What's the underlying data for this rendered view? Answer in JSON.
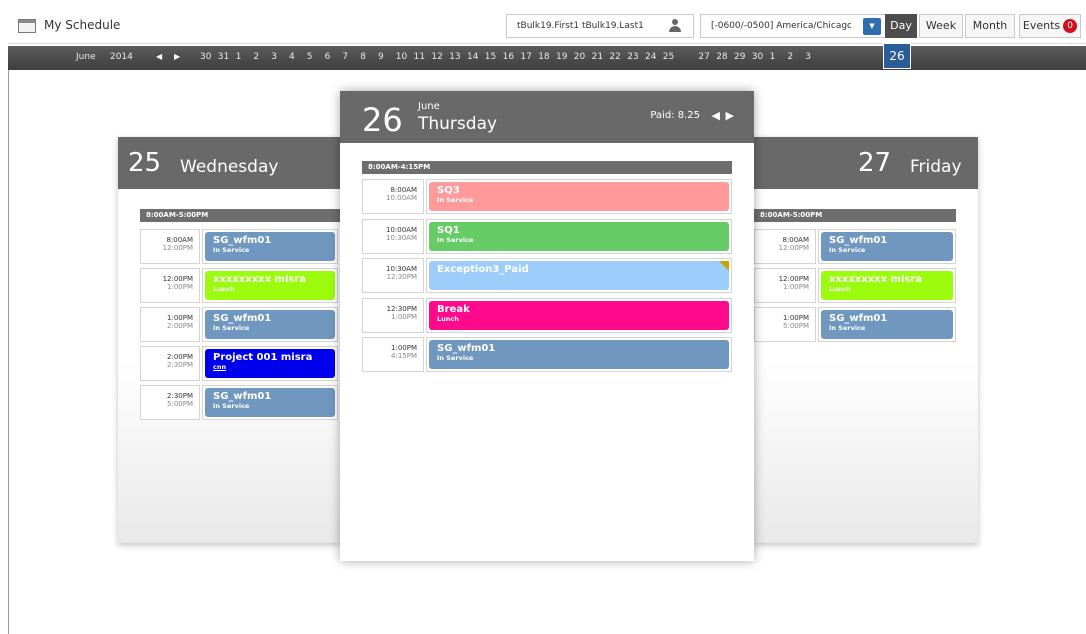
{
  "app": {
    "title": "My Schedule"
  },
  "user": {
    "name": "tBulk19.First1 tBulk19.Last1"
  },
  "timezone": {
    "value": "[-0600/-0500] America/Chicago"
  },
  "views": {
    "day": "Day",
    "week": "Week",
    "month": "Month",
    "events": "Events",
    "events_count": "0"
  },
  "datebar": {
    "month": "June",
    "year": "2014",
    "dates": [
      "30",
      "31",
      "1",
      "2",
      "3",
      "4",
      "5",
      "6",
      "7",
      "8",
      "9",
      "10",
      "11",
      "12",
      "13",
      "14",
      "15",
      "16",
      "17",
      "18",
      "19",
      "20",
      "21",
      "22",
      "23",
      "24",
      "25",
      "26",
      "27",
      "28",
      "29",
      "30",
      "1",
      "2",
      "3"
    ],
    "current": "26"
  },
  "days": {
    "prev": {
      "num": "25",
      "name": "Wednesday",
      "shift": "8:00AM-5:00PM",
      "events": [
        {
          "start": "8:00AM",
          "end": "12:00PM",
          "name": "SG_wfm01",
          "sub": "In Service",
          "color": "#6f97c0"
        },
        {
          "start": "12:00PM",
          "end": "1:00PM",
          "name": "xxxxxxxxx misra",
          "sub": "Lunch",
          "color": "#9bfc0e"
        },
        {
          "start": "1:00PM",
          "end": "2:00PM",
          "name": "SG_wfm01",
          "sub": "In Service",
          "color": "#6f97c0"
        },
        {
          "start": "2:00PM",
          "end": "2:30PM",
          "name": "Project 001 misra",
          "sub": "cnn",
          "color": "#0000ee"
        },
        {
          "start": "2:30PM",
          "end": "5:00PM",
          "name": "SG_wfm01",
          "sub": "In Service",
          "color": "#6f97c0"
        }
      ]
    },
    "current": {
      "num": "26",
      "month": "June",
      "name": "Thursday",
      "paid": "Paid: 8.25",
      "shift": "8:00AM-4:15PM",
      "events": [
        {
          "start": "8:00AM",
          "end": "10:00AM",
          "name": "SQ3",
          "sub": "In Service",
          "color": "#ff9a9a"
        },
        {
          "start": "10:00AM",
          "end": "10:30AM",
          "name": "SQ1",
          "sub": "In Service",
          "color": "#66cc66"
        },
        {
          "start": "10:30AM",
          "end": "12:30PM",
          "name": "Exception3_Paid",
          "sub": "",
          "color": "#9ccdfb"
        },
        {
          "start": "12:30PM",
          "end": "1:00PM",
          "name": "Break",
          "sub": "Lunch",
          "color": "#ff0a8c"
        },
        {
          "start": "1:00PM",
          "end": "4:15PM",
          "name": "SG_wfm01",
          "sub": "In Service",
          "color": "#6f97c0"
        }
      ]
    },
    "next": {
      "num": "27",
      "name": "Friday",
      "shift": "8:00AM-5:00PM",
      "events": [
        {
          "start": "8:00AM",
          "end": "12:00PM",
          "name": "SG_wfm01",
          "sub": "In Service",
          "color": "#6f97c0"
        },
        {
          "start": "12:00PM",
          "end": "1:00PM",
          "name": "xxxxxxxxx misra",
          "sub": "Lunch",
          "color": "#9bfc0e"
        },
        {
          "start": "1:00PM",
          "end": "5:00PM",
          "name": "SG_wfm01",
          "sub": "In Service",
          "color": "#6f97c0"
        }
      ]
    }
  }
}
